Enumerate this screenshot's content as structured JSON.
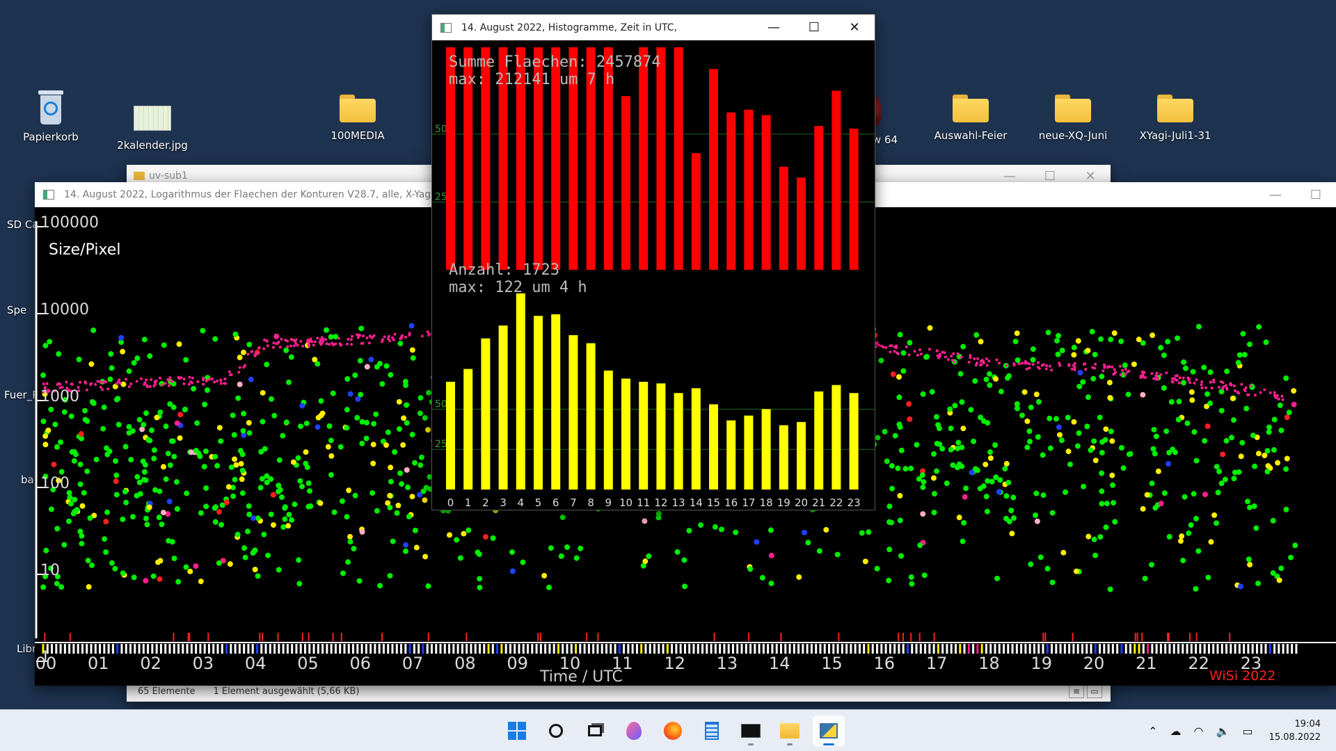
{
  "desktop": {
    "icons": [
      {
        "label": "Papierkorb",
        "kind": "recycle-bin"
      },
      {
        "label": "2kalender.jpg",
        "kind": "image"
      },
      {
        "label": "100MEDIA",
        "kind": "folder"
      },
      {
        "label": "w 64",
        "kind": "app"
      },
      {
        "label": "Auswahl-Feier",
        "kind": "folder"
      },
      {
        "label": "neue-XQ-Juni",
        "kind": "folder"
      },
      {
        "label": "XYagi-Juli1-31",
        "kind": "folder"
      }
    ],
    "side_labels": [
      "SD Ca",
      "Spe",
      "Fuer_P",
      "ba",
      "Libr"
    ]
  },
  "explorer": {
    "title": "uv-sub1",
    "status_count": "65 Elemente",
    "status_selection": "1 Element ausgewählt (5,66 KB)"
  },
  "scatter_window": {
    "title": "14. August 2022, Logarithmus der Flaechen der Konturen V28.7, alle, X-Yagi",
    "y_title": "Size/Pixel",
    "x_title": "Time  /  UTC",
    "watermark": "WiSi 2022",
    "y_ticks": [
      "100000",
      "10000",
      "1000",
      "100",
      "10",
      "1"
    ],
    "x_ticks": [
      "00",
      "01",
      "02",
      "03",
      "04",
      "05",
      "06",
      "07",
      "08",
      "09",
      "10",
      "11",
      "12",
      "13",
      "14",
      "15",
      "16",
      "17",
      "18",
      "19",
      "20",
      "21",
      "22",
      "23"
    ],
    "colors": {
      "green": "#00ee00",
      "yellow": "#ffee00",
      "red": "#ff2020",
      "blue": "#2040ff",
      "magenta": "#ff2090",
      "pink": "#ffb0c0"
    }
  },
  "histo_window": {
    "title": "14. August 2022, Histogramme, Zeit in UTC,",
    "area_text_1": "Summe Flaechen: 2457874",
    "area_text_2": "max: 212141 um 7 h",
    "count_text_1": "Anzahl: 1723",
    "count_text_2": "max: 122 um 4 h",
    "area_ticks": [
      "50k",
      "25k"
    ],
    "count_ticks": [
      "50",
      "25"
    ]
  },
  "chart_data": [
    {
      "type": "bar",
      "title": "Summe Flaechen: 2457874",
      "subtitle": "max: 212141 um 7 h",
      "categories": [
        "0",
        "1",
        "2",
        "3",
        "4",
        "5",
        "6",
        "7",
        "8",
        "9",
        "10",
        "11",
        "12",
        "13",
        "14",
        "15",
        "16",
        "17",
        "18",
        "19",
        "20",
        "21",
        "22",
        "23"
      ],
      "values": [
        85000,
        90000,
        95000,
        120000,
        110000,
        150000,
        95000,
        212141,
        180000,
        85000,
        64000,
        90000,
        95000,
        92000,
        43000,
        74000,
        58000,
        59000,
        57000,
        38000,
        34000,
        53000,
        66000,
        52000
      ],
      "ylim": [
        0,
        82000
      ],
      "yticks": [
        "25k",
        "50k"
      ],
      "color": "#ff0000",
      "grid": true
    },
    {
      "type": "bar",
      "title": "Anzahl: 1723",
      "subtitle": "max: 122 um 4 h",
      "categories": [
        "0",
        "1",
        "2",
        "3",
        "4",
        "5",
        "6",
        "7",
        "8",
        "9",
        "10",
        "11",
        "12",
        "13",
        "14",
        "15",
        "16",
        "17",
        "18",
        "19",
        "20",
        "21",
        "22",
        "23"
      ],
      "values": [
        67,
        75,
        94,
        102,
        122,
        108,
        109,
        96,
        91,
        74,
        69,
        67,
        66,
        60,
        63,
        53,
        43,
        46,
        50,
        40,
        42,
        61,
        65,
        60
      ],
      "ylim": [
        0,
        160
      ],
      "yticks": [
        "25",
        "50"
      ],
      "color": "#ffff00",
      "grid": true
    }
  ],
  "taskbar": {
    "apps": [
      "windows-start",
      "search",
      "task-view",
      "paint-drop",
      "firefox",
      "notepad",
      "terminal",
      "file-explorer",
      "python-window"
    ],
    "time": "19:04",
    "date": "15.08.2022"
  }
}
